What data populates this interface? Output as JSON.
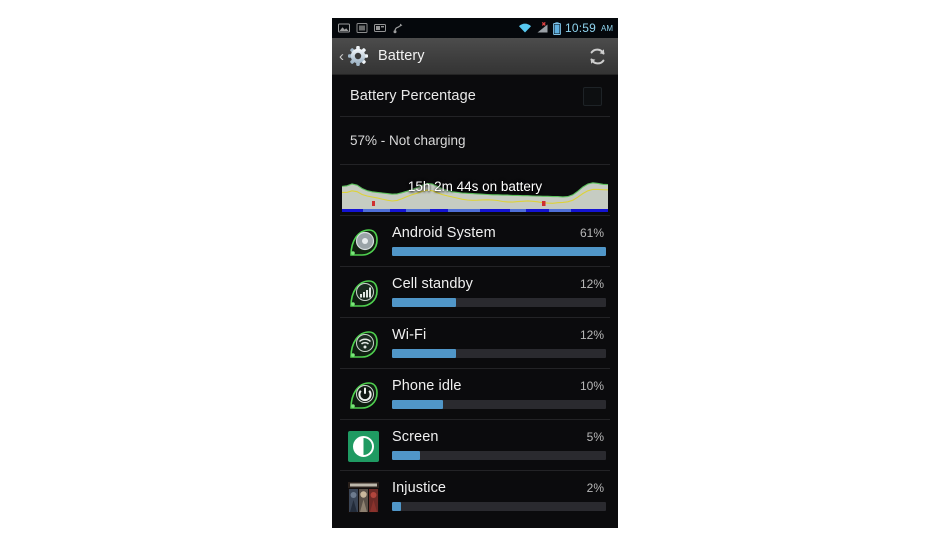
{
  "status_bar": {
    "icons": [
      {
        "name": "image-icon",
        "glyph": "picture"
      },
      {
        "name": "screenshot-icon",
        "glyph": "screenshot"
      },
      {
        "name": "sd-card-icon",
        "glyph": "sdcard"
      },
      {
        "name": "usb-icon",
        "glyph": "usb"
      }
    ],
    "wifi_icon": "wifi-icon",
    "signal_icon": "cellular-signal-no-service-icon",
    "battery_icon": "battery-icon",
    "time": "10:59",
    "ampm": "AM",
    "time_color": "#8fd4ef"
  },
  "action_bar": {
    "back_glyph": "‹",
    "back_icon": "back-chevron-icon",
    "gear_icon": "settings-gear-icon",
    "title": "Battery",
    "refresh_icon": "refresh-icon"
  },
  "battery_percentage_pref": {
    "label": "Battery Percentage",
    "checked": false
  },
  "charge_status": {
    "text": "57% - Not charging",
    "percent": 57
  },
  "history_graph": {
    "label": "15h 2m 44s on battery",
    "duration": "15h 2m 44s",
    "fill_color": "#c8cec4",
    "edge_color": "#5ec25e",
    "level_line_color": "#e0d43c",
    "marker_color": "#d03030",
    "baseline_color": "#1414d2",
    "levels": [
      62,
      64,
      70,
      66,
      55,
      48,
      44,
      42,
      40,
      38,
      36,
      37,
      41,
      46,
      52,
      58,
      66,
      72,
      70,
      62,
      54,
      48,
      44,
      42,
      40,
      39,
      38,
      37,
      36,
      35,
      34,
      34,
      33,
      33,
      32,
      32,
      31,
      31,
      30,
      30,
      29,
      29,
      28,
      28,
      27,
      28,
      34,
      46,
      60,
      70,
      74,
      72,
      69,
      68
    ]
  },
  "apps": [
    {
      "name": "Android System",
      "percent_label": "61%",
      "percent": 61,
      "bar_width_pct": 100,
      "icon": "android-system-icon",
      "icon_type": "droplet-disc"
    },
    {
      "name": "Cell standby",
      "percent_label": "12%",
      "percent": 12,
      "bar_width_pct": 30,
      "icon": "cell-standby-icon",
      "icon_type": "droplet-bars"
    },
    {
      "name": "Wi-Fi",
      "percent_label": "12%",
      "percent": 12,
      "bar_width_pct": 30,
      "icon": "wifi-usage-icon",
      "icon_type": "droplet-wifi"
    },
    {
      "name": "Phone idle",
      "percent_label": "10%",
      "percent": 10,
      "bar_width_pct": 24,
      "icon": "phone-idle-icon",
      "icon_type": "droplet-power"
    },
    {
      "name": "Screen",
      "percent_label": "5%",
      "percent": 5,
      "bar_width_pct": 13,
      "icon": "screen-brightness-icon",
      "icon_type": "tile-brightness"
    },
    {
      "name": "Injustice",
      "percent_label": "2%",
      "percent": 2,
      "bar_width_pct": 4,
      "icon": "injustice-app-icon",
      "icon_type": "tile-game"
    }
  ],
  "colors": {
    "accent_bar": "#5096c8",
    "track": "#2a2a2f",
    "screen_bg": "#0b0b0d",
    "action_bar": "#3e3e3e",
    "page_bg": "#ffffff"
  }
}
